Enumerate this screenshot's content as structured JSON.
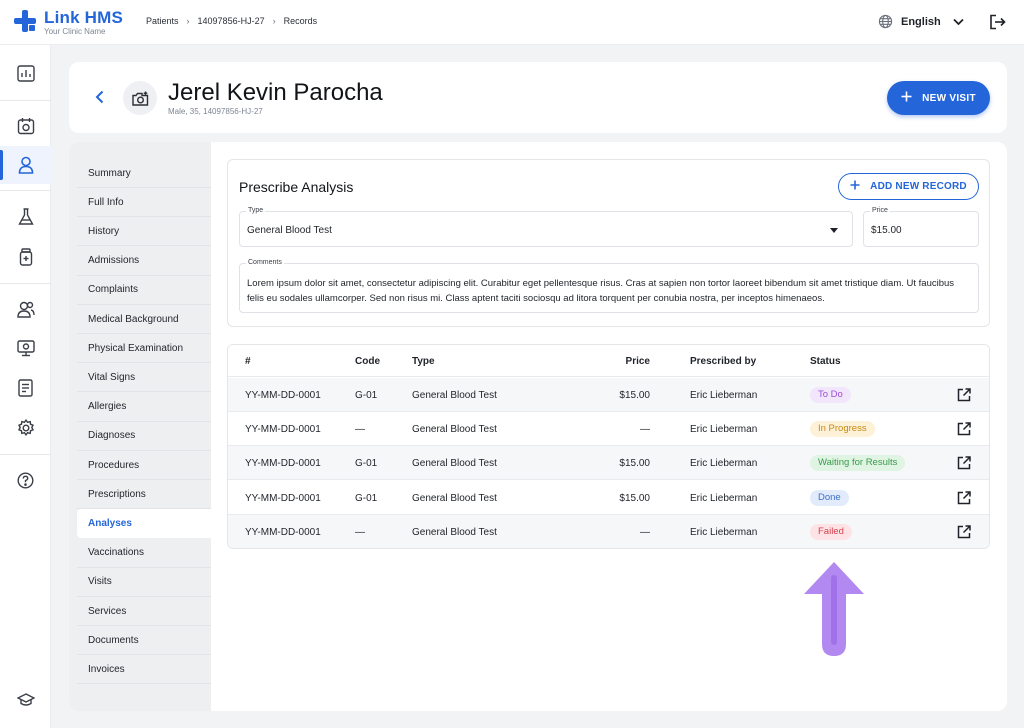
{
  "app": {
    "name": "Link HMS",
    "clinic": "Your Clinic Name"
  },
  "breadcrumb": [
    "Patients",
    "14097856-HJ-27",
    "Records"
  ],
  "language": "English",
  "patient": {
    "name": "Jerel Kevin Parocha",
    "meta": "Male, 35, 14097856-HJ-27"
  },
  "header": {
    "new_visit_label": "NEW VISIT"
  },
  "subnav": [
    "Summary",
    "Full Info",
    "History",
    "Admissions",
    "Complaints",
    "Medical Background",
    "Physical Examination",
    "Vital Signs",
    "Allergies",
    "Diagnoses",
    "Procedures",
    "Prescriptions",
    "Analyses",
    "Vaccinations",
    "Visits",
    "Services",
    "Documents",
    "Invoices"
  ],
  "subnav_active": "Analyses",
  "form": {
    "title": "Prescribe Analysis",
    "add_record_label": "ADD NEW RECORD",
    "type_label": "Type",
    "type_value": "General Blood Test",
    "price_label": "Price",
    "price_value": "$15.00",
    "comments_label": "Comments",
    "comments_value": "Lorem ipsum dolor sit amet, consectetur adipiscing elit. Curabitur eget pellentesque risus. Cras at sapien non tortor laoreet bibendum sit amet tristique diam. Ut faucibus felis eu sodales ullamcorper. Sed non risus mi. Class aptent taciti sociosqu ad litora torquent per conubia nostra, per inceptos himenaeos."
  },
  "table": {
    "headers": {
      "num": "#",
      "code": "Code",
      "type": "Type",
      "price": "Price",
      "prescribed_by": "Prescribed by",
      "status": "Status"
    },
    "rows": [
      {
        "id": "YY-MM-DD-0001",
        "code": "G-01",
        "type": "General Blood Test",
        "price": "$15.00",
        "by": "Eric Lieberman",
        "status": "To Do"
      },
      {
        "id": "YY-MM-DD-0001",
        "code": "—",
        "type": "General Blood Test",
        "price": "—",
        "by": "Eric Lieberman",
        "status": "In Progress"
      },
      {
        "id": "YY-MM-DD-0001",
        "code": "G-01",
        "type": "General Blood Test",
        "price": "$15.00",
        "by": "Eric Lieberman",
        "status": "Waiting for Results"
      },
      {
        "id": "YY-MM-DD-0001",
        "code": "G-01",
        "type": "General Blood Test",
        "price": "$15.00",
        "by": "Eric Lieberman",
        "status": "Done"
      },
      {
        "id": "YY-MM-DD-0001",
        "code": "—",
        "type": "General Blood Test",
        "price": "—",
        "by": "Eric Lieberman",
        "status": "Failed"
      }
    ]
  },
  "status_colors": {
    "To Do": {
      "bg": "#f1e6fb",
      "fg": "#9b4fd6"
    },
    "In Progress": {
      "bg": "#fdf1d8",
      "fg": "#c98a10"
    },
    "Waiting for Results": {
      "bg": "#e0f4e3",
      "fg": "#3a9a4d"
    },
    "Done": {
      "bg": "#e1ebfb",
      "fg": "#3d6fc9"
    },
    "Failed": {
      "bg": "#fde3e5",
      "fg": "#d4424f"
    }
  },
  "colors": {
    "accent": "#2466d9",
    "annotation_arrow": "#b289f0"
  },
  "icons": {
    "rail": [
      "dashboard-icon",
      "calendar-icon",
      "patient-icon",
      "lab-flask-icon",
      "medicine-bottle-icon",
      "staff-icon",
      "monitor-icon",
      "report-icon",
      "settings-icon",
      "help-icon",
      "education-icon"
    ],
    "row_action": "open-external-icon"
  }
}
